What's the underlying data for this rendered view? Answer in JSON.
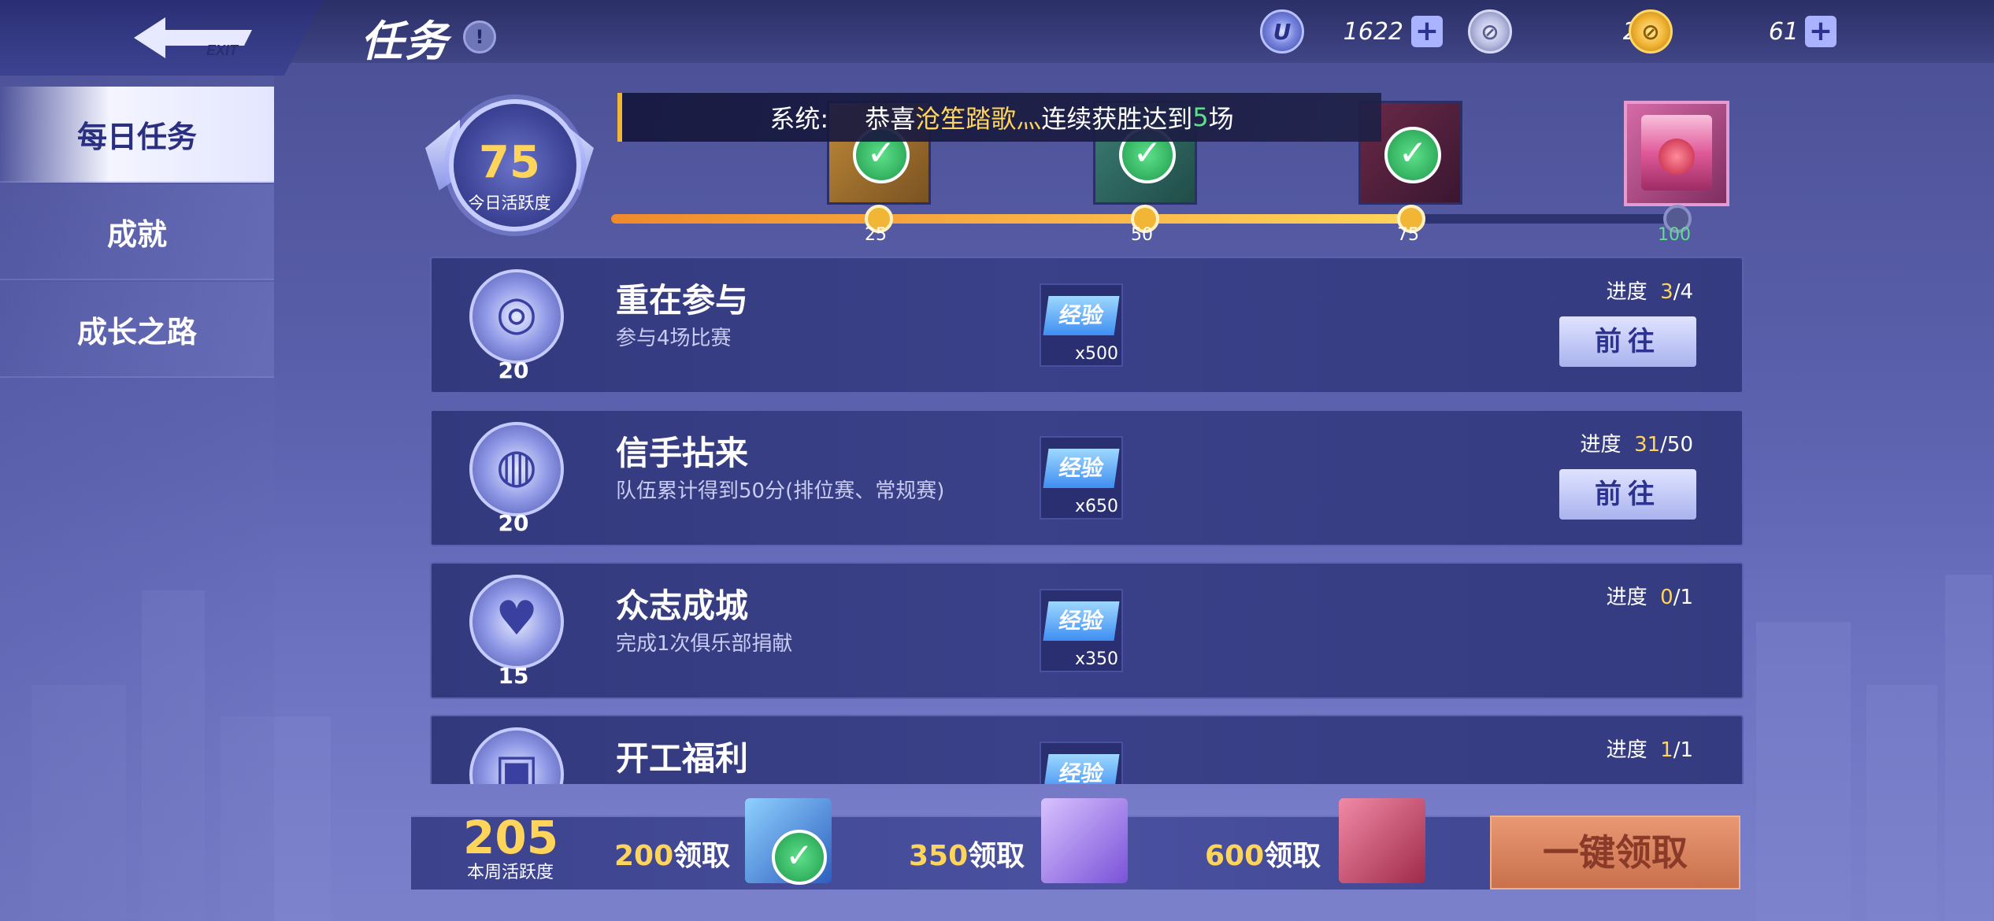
{
  "header": {
    "title": "任务",
    "info_icon": "!",
    "exit_label": "EXIT",
    "currencies": [
      {
        "icon": "u-coin-icon",
        "value": "1622",
        "has_plus": true
      },
      {
        "icon": "basketball-coin-icon",
        "value": "2",
        "has_plus": false
      },
      {
        "icon": "gold-coin-icon",
        "value": "61",
        "has_plus": true
      }
    ],
    "plus_label": "+"
  },
  "sidebar": {
    "items": [
      {
        "label": "每日任务",
        "active": true
      },
      {
        "label": "成就",
        "active": false
      },
      {
        "label": "成长之路",
        "active": false
      }
    ]
  },
  "activity": {
    "today_value": "75",
    "today_label": "今日活跃度",
    "progress": 0.75,
    "milestones": [
      "25",
      "50",
      "75",
      "100"
    ],
    "claimed": [
      true,
      true,
      true,
      false
    ]
  },
  "notice": {
    "prefix": "系统:",
    "text_before": "恭喜",
    "player": "沧笙踏歌灬",
    "text_mid": "连续获胜达到",
    "count": "5",
    "text_after": "场"
  },
  "tasks": [
    {
      "title": "重在参与",
      "desc": "参与4场比赛",
      "points": "20",
      "icon": "basketball-icon",
      "reward_label": "经验",
      "reward_qty": "x500",
      "progress_label": "进度",
      "progress_cur": "3",
      "progress_total": "/4",
      "button": "前往"
    },
    {
      "title": "信手拈来",
      "desc": "队伍累计得到50分(排位赛、常规赛)",
      "points": "20",
      "icon": "basketball-hoop-icon",
      "reward_label": "经验",
      "reward_qty": "x650",
      "progress_label": "进度",
      "progress_cur": "31",
      "progress_total": "/50",
      "button": "前往"
    },
    {
      "title": "众志成城",
      "desc": "完成1次俱乐部捐献",
      "points": "15",
      "icon": "piggy-bank-icon",
      "reward_label": "经验",
      "reward_qty": "x350",
      "progress_label": "进度",
      "progress_cur": "0",
      "progress_total": "/1",
      "button": ""
    },
    {
      "title": "开工福利",
      "desc": "",
      "points": "",
      "icon": "id-card-icon",
      "reward_label": "经验",
      "reward_qty": "",
      "progress_label": "进度",
      "progress_cur": "1",
      "progress_total": "/1",
      "button": ""
    }
  ],
  "weekly": {
    "value": "205",
    "label": "本周活跃度",
    "claims": [
      {
        "threshold": "200",
        "label": "领取",
        "claimed": true
      },
      {
        "threshold": "350",
        "label": "领取",
        "claimed": false
      },
      {
        "threshold": "600",
        "label": "领取",
        "claimed": false
      }
    ],
    "claim_all": "一键领取"
  },
  "colors": {
    "accent_yellow": "#ffd45a",
    "green": "#5ee08a",
    "panel": "#3b4188"
  }
}
